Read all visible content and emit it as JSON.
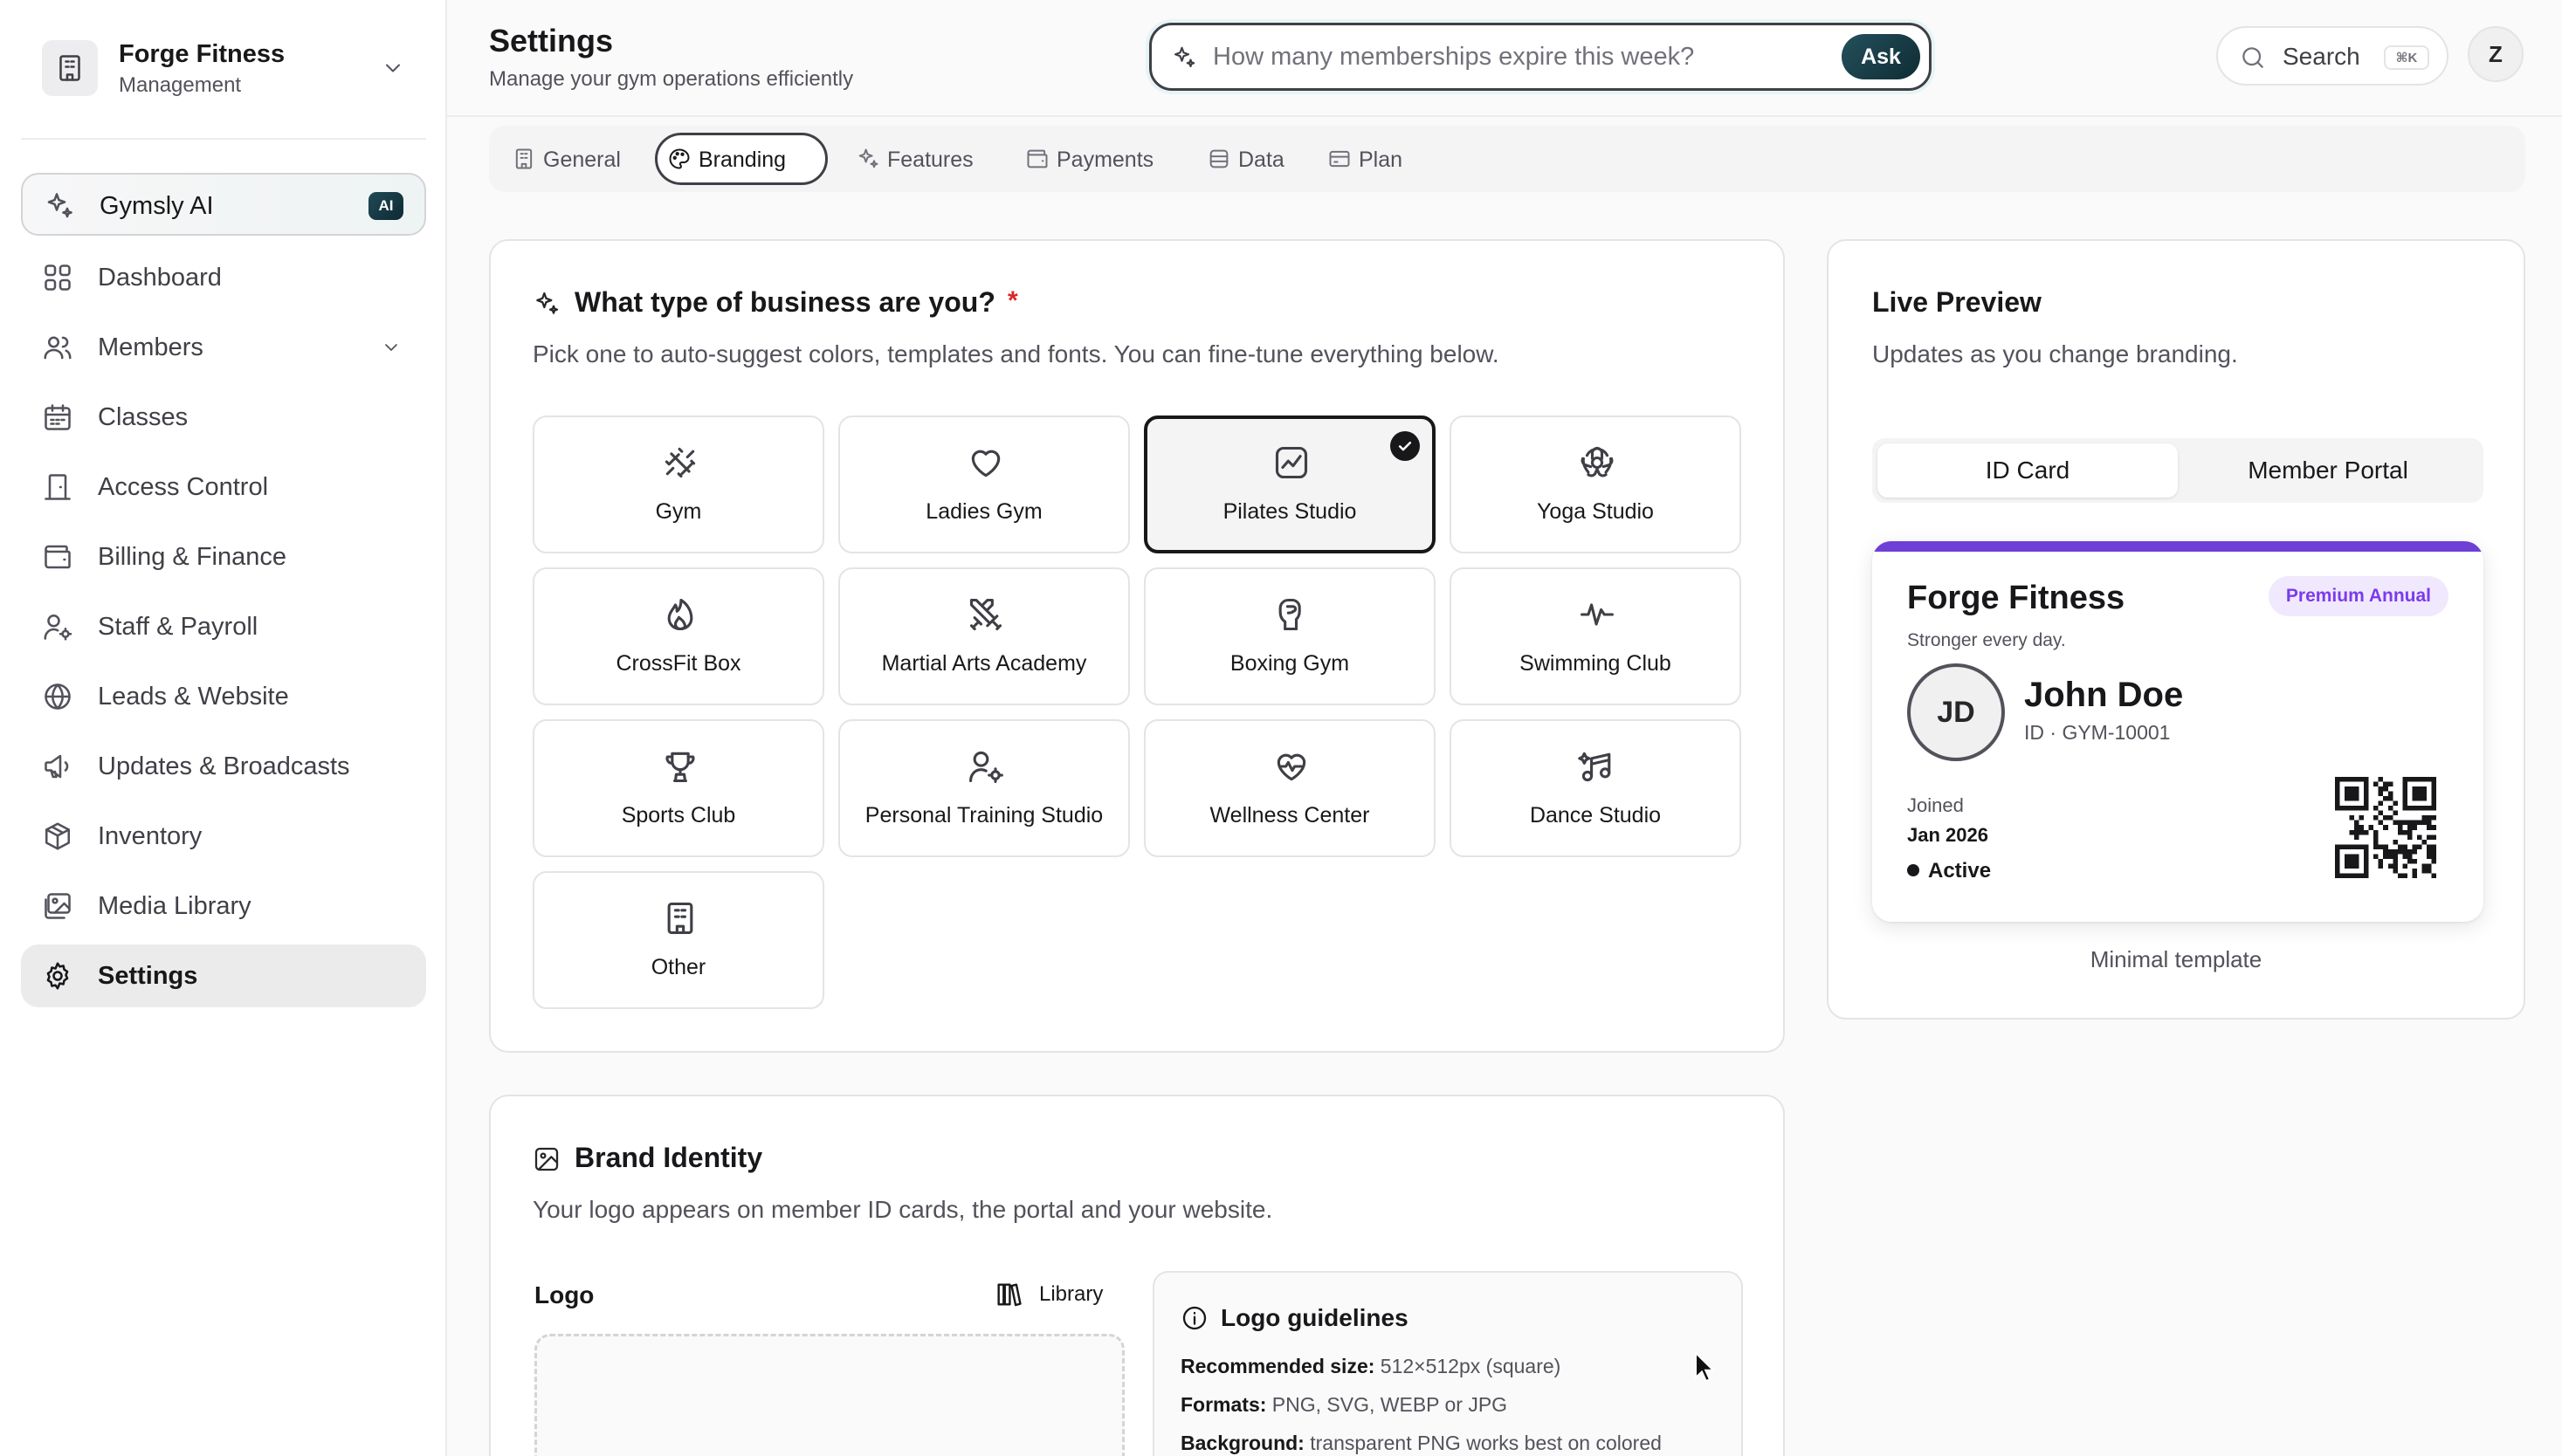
{
  "sidebar": {
    "org_name": "Forge Fitness",
    "org_role": "Management",
    "ai_item": {
      "label": "Gymsly AI",
      "badge": "AI"
    },
    "items": [
      {
        "label": "Dashboard"
      },
      {
        "label": "Members"
      },
      {
        "label": "Classes"
      },
      {
        "label": "Access Control"
      },
      {
        "label": "Billing & Finance"
      },
      {
        "label": "Staff & Payroll"
      },
      {
        "label": "Leads & Website"
      },
      {
        "label": "Updates & Broadcasts"
      },
      {
        "label": "Inventory"
      },
      {
        "label": "Media Library"
      },
      {
        "label": "Settings"
      }
    ]
  },
  "header": {
    "title": "Settings",
    "subtitle": "Manage your gym operations efficiently",
    "ask_placeholder": "How many memberships expire this week?",
    "ask_button": "Ask",
    "search_label": "Search",
    "search_shortcut": "⌘K",
    "avatar_initial": "Z"
  },
  "tabs": [
    {
      "label": "General"
    },
    {
      "label": "Branding"
    },
    {
      "label": "Features"
    },
    {
      "label": "Payments"
    },
    {
      "label": "Data"
    },
    {
      "label": "Plan"
    }
  ],
  "business_type": {
    "title": "What type of business are you?",
    "required_mark": "*",
    "description": "Pick one to auto-suggest colors, templates and fonts. You can fine-tune everything below.",
    "selected": "Pilates Studio",
    "options": [
      {
        "label": "Gym",
        "icon": "dumbbell-icon"
      },
      {
        "label": "Ladies Gym",
        "icon": "heart-icon"
      },
      {
        "label": "Pilates Studio",
        "icon": "activity-icon"
      },
      {
        "label": "Yoga Studio",
        "icon": "flower-icon"
      },
      {
        "label": "CrossFit Box",
        "icon": "flame-icon"
      },
      {
        "label": "Martial Arts Academy",
        "icon": "swords-icon"
      },
      {
        "label": "Boxing Gym",
        "icon": "boxing-glove-icon"
      },
      {
        "label": "Swimming Club",
        "icon": "wave-icon"
      },
      {
        "label": "Sports Club",
        "icon": "trophy-icon"
      },
      {
        "label": "Personal Training Studio",
        "icon": "user-cog-icon"
      },
      {
        "label": "Wellness Center",
        "icon": "heart-pulse-icon"
      },
      {
        "label": "Dance Studio",
        "icon": "music-icon"
      },
      {
        "label": "Other",
        "icon": "building-icon"
      }
    ]
  },
  "preview": {
    "title": "Live Preview",
    "description": "Updates as you change branding.",
    "tabs": [
      {
        "label": "ID Card"
      },
      {
        "label": "Member Portal"
      }
    ],
    "card": {
      "gym_name": "Forge Fitness",
      "tagline": "Stronger every day.",
      "plan_badge": "Premium Annual",
      "initials": "JD",
      "member_name": "John Doe",
      "member_id": "ID · GYM-10001",
      "joined_label": "Joined",
      "joined_value": "Jan 2026",
      "status": "Active",
      "accent_color": "#6d3fd6"
    },
    "template_name": "Minimal template"
  },
  "brand_identity": {
    "title": "Brand Identity",
    "description": "Your logo appears on member ID cards, the portal and your website.",
    "logo_label": "Logo",
    "library_label": "Library",
    "guidelines": {
      "title": "Logo guidelines",
      "lines": [
        {
          "key": "Recommended size:",
          "value": "512×512px (square)"
        },
        {
          "key": "Formats:",
          "value": "PNG, SVG, WEBP or JPG"
        },
        {
          "key": "Background:",
          "value": "transparent PNG works best on colored"
        }
      ]
    }
  }
}
